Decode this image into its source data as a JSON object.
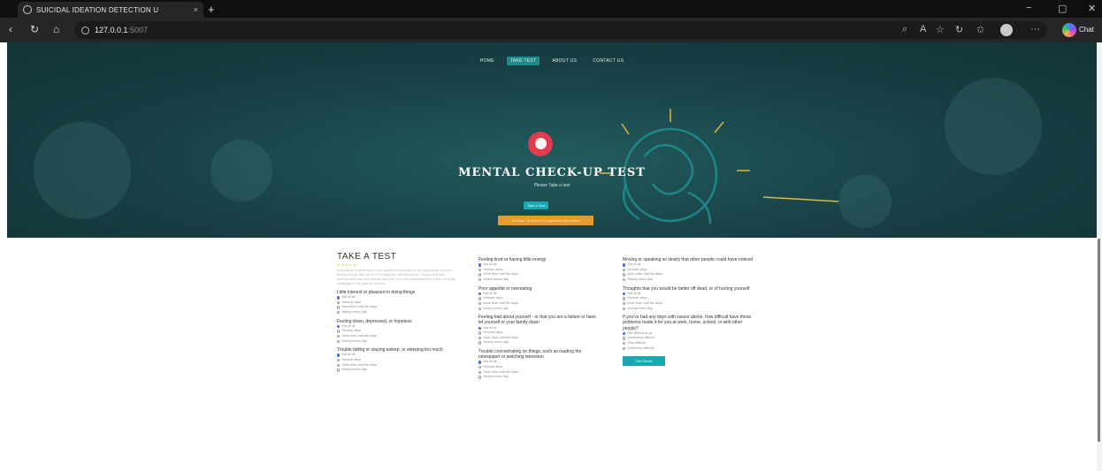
{
  "browser": {
    "tab_title": "SUICIDAL IDEATION DETECTION U",
    "close_glyph": "×",
    "new_tab_glyph": "+",
    "url_host": "127.0.0.1",
    "url_port": ":5007",
    "copilot_label": "Chat",
    "menu_glyph": "···",
    "minimize_glyph": "−",
    "maximize_glyph": "▢",
    "window_close_glyph": "✕"
  },
  "nav": {
    "items": [
      {
        "label": "HOME"
      },
      {
        "label": "TAKE TEST"
      },
      {
        "label": "ABOUT US"
      },
      {
        "label": "CONTACT US"
      }
    ]
  },
  "hero": {
    "title": "MENTAL CHECK-UP TEST",
    "subtitle": "Please Take a test",
    "take_button": "Take a Test",
    "orange_button": "Go Back To Home For Updated Information"
  },
  "test": {
    "title": "TAKE A TEST",
    "stars": "★★★★★",
    "intro": "Instructions: Answer each of the questions from below to the appropriate columns. Among people, this can be from diagnosis with depression. Thanks and each question response and indicate how often you have experienced the below or similar challenges in the past two months.",
    "questions": [
      {
        "text": "Little interest or pleasure in doing things",
        "options": [
          "Not at all",
          "Several days",
          "More than half the days",
          "Nearly every day"
        ],
        "selected": 0
      },
      {
        "text": "Feeling down, depressed, or hopeless",
        "options": [
          "Not at all",
          "Several days",
          "More than half the days",
          "Nearly every day"
        ],
        "selected": 0
      },
      {
        "text": "Trouble falling or staying asleep, or sleeping too much",
        "options": [
          "Not at all",
          "Several days",
          "More than half the days",
          "Nearly every day"
        ],
        "selected": 0
      },
      {
        "text": "Feeling tired or having little energy",
        "options": [
          "Not at all",
          "Several days",
          "More than half the days",
          "Nearly every day"
        ],
        "selected": 0
      },
      {
        "text": "Poor appetite or overeating",
        "options": [
          "Not at all",
          "Several days",
          "More than half the days",
          "Nearly every day"
        ],
        "selected": 0
      },
      {
        "text": "Feeling bad about yourself - or that you are a failure or have let yourself or your family down",
        "options": [
          "Not at all",
          "Several days",
          "More than half the days",
          "Nearly every day"
        ],
        "selected": 0
      },
      {
        "text": "Trouble concentrating on things, such as reading the newspaper or watching television",
        "options": [
          "Not at all",
          "Several days",
          "More than half the days",
          "Nearly every day"
        ],
        "selected": 0
      },
      {
        "text": "Moving or speaking so slowly that other people could have noticed",
        "options": [
          "Not at all",
          "Several days",
          "More than half the days",
          "Nearly every day"
        ],
        "selected": 0
      },
      {
        "text": "Thoughts that you would be better off dead, or of hurting yourself",
        "options": [
          "Not at all",
          "Several days",
          "More than half the days",
          "Nearly every day"
        ],
        "selected": 0
      },
      {
        "text": "If you've had any days with issues above, how difficult have these problems made it for you at work, home, school, or with other people?",
        "options": [
          "Not difficult at all",
          "Somewhat difficult",
          "Very difficult",
          "Extremely difficult"
        ],
        "selected": 0
      }
    ],
    "submit_label": "Get Result"
  }
}
